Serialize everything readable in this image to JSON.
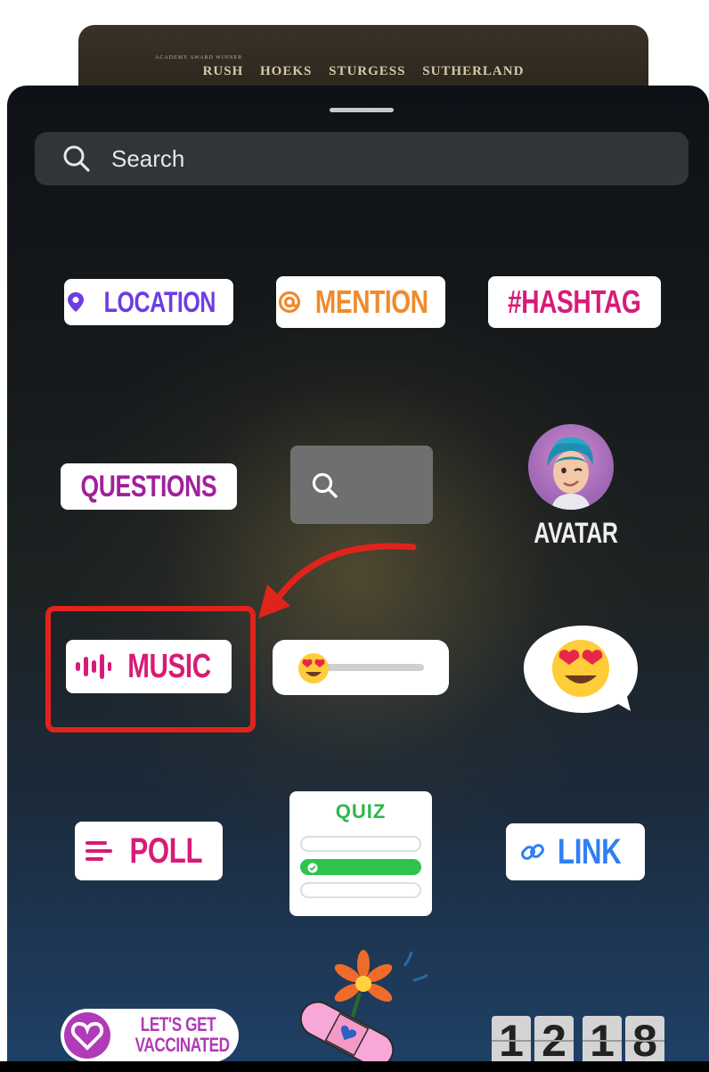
{
  "poster": {
    "subtitle": "ACADEMY AWARD WINNER",
    "names": "RUSH HOEKS STURGESS SUTHERLAND"
  },
  "search": {
    "placeholder": "Search"
  },
  "stickers": {
    "location": "LOCATION",
    "mention": "MENTION",
    "hashtag": "#HASHTAG",
    "questions": "QUESTIONS",
    "avatar": "AVATAR",
    "music": "MUSIC",
    "poll": "POLL",
    "quiz": "QUIZ",
    "link": "LINK",
    "vaccinated_line1": "LET'S GET",
    "vaccinated_line2": "VACCINATED",
    "clock_digits": [
      "1",
      "2",
      "1",
      "8"
    ]
  },
  "icons": {
    "search": "search-icon",
    "location_pin": "location-pin-icon",
    "mention_at": "at-sign-icon",
    "music_wave": "audio-wave-icon",
    "poll_lines": "poll-lines-icon",
    "link_chain": "link-icon",
    "heart_eyes": "heart-eyes-emoji-icon"
  },
  "highlight": {
    "target": "music",
    "color": "#e0231c"
  },
  "colors": {
    "location": "#6c3de0",
    "mention": "#f08a2a",
    "hashtag": "#d81b76",
    "questions": "#a0219a",
    "music": "#d81b76",
    "poll": "#d81b76",
    "quiz": "#2bb84a",
    "link": "#2f7ff0",
    "vaccinated": "#b03ab7"
  }
}
